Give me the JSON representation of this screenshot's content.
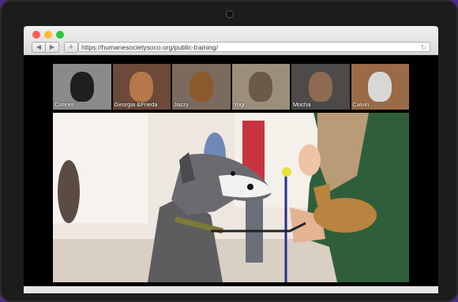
{
  "browser": {
    "url": "https://humanesocietysoco.org/public-training/",
    "back_symbol": "◀",
    "forward_symbol": "▶",
    "new_tab_symbol": "+",
    "reload_symbol": "↻"
  },
  "thumbnails": [
    {
      "name": "Conner",
      "bg": "#8a8a8a",
      "face": "#1f1f1f"
    },
    {
      "name": "Georgia &Frieda",
      "bg": "#6b4a3a",
      "face": "#b5784a"
    },
    {
      "name": "Jazzy",
      "bg": "#7b6a5e",
      "face": "#8b5a2b"
    },
    {
      "name": "Yogi",
      "bg": "#9b8f7b",
      "face": "#6b5a48"
    },
    {
      "name": "Mocha",
      "bg": "#4d4a4a",
      "face": "#8e6a52"
    },
    {
      "name": "Calvin",
      "bg": "#9a6b46",
      "face": "#d7d7d7"
    }
  ]
}
